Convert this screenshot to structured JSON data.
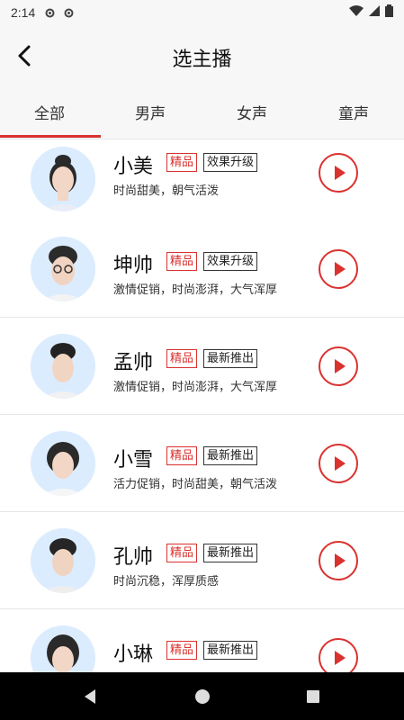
{
  "statusbar": {
    "time": "2:14"
  },
  "header": {
    "title": "选主播"
  },
  "tabs": [
    {
      "label": "全部"
    },
    {
      "label": "男声"
    },
    {
      "label": "女声"
    },
    {
      "label": "童声"
    }
  ],
  "voices": [
    {
      "name": "小美",
      "tag_red": "精品",
      "tag_black": "效果升级",
      "desc": "时尚甜美，朝气活泼",
      "gender": "female"
    },
    {
      "name": "坤帅",
      "tag_red": "精品",
      "tag_black": "效果升级",
      "desc": "激情促销，时尚澎湃，大气浑厚",
      "gender": "male-glasses"
    },
    {
      "name": "孟帅",
      "tag_red": "精品",
      "tag_black": "最新推出",
      "desc": "激情促销，时尚澎湃，大气浑厚",
      "gender": "male"
    },
    {
      "name": "小雪",
      "tag_red": "精品",
      "tag_black": "最新推出",
      "desc": "活力促销，时尚甜美，朝气活泼",
      "gender": "female-bob"
    },
    {
      "name": "孔帅",
      "tag_red": "精品",
      "tag_black": "最新推出",
      "desc": "时尚沉稳，浑厚质感",
      "gender": "male-young"
    },
    {
      "name": "小琳",
      "tag_red": "精品",
      "tag_black": "最新推出",
      "desc": "",
      "gender": "female"
    }
  ],
  "colors": {
    "accent": "#d9322f",
    "navbar": "#000000"
  },
  "icons": {
    "back": "chevron-left-icon",
    "play": "play-icon"
  }
}
